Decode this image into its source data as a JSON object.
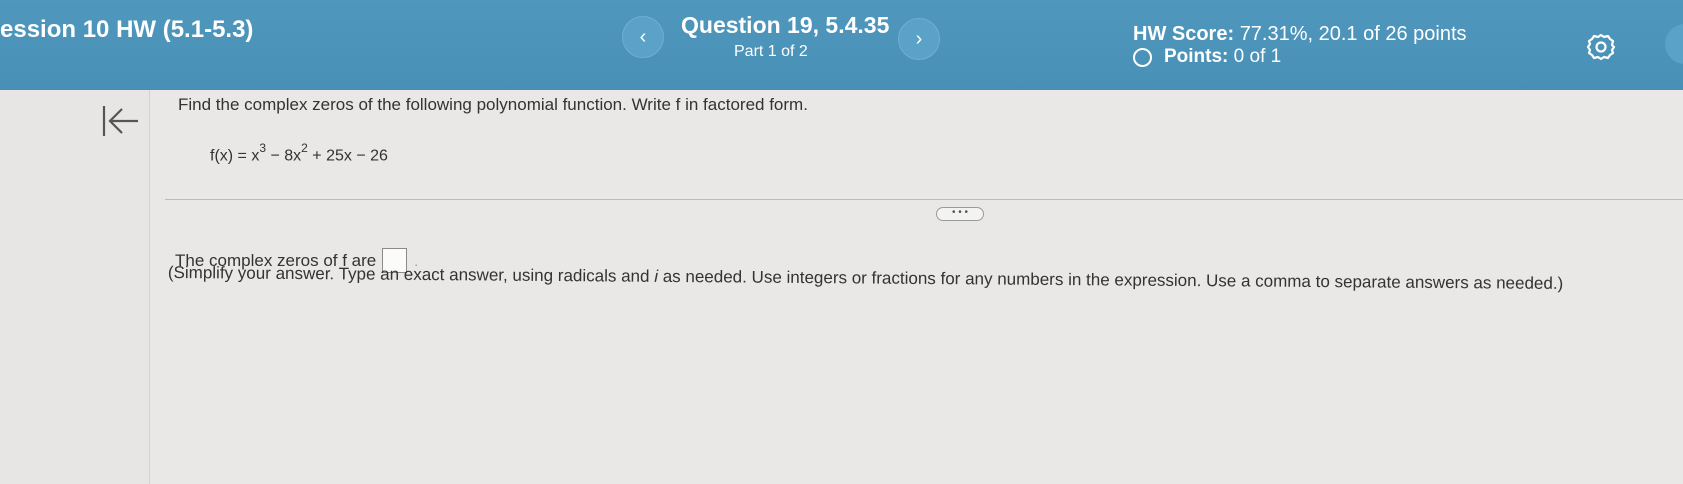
{
  "header": {
    "hw_title": "ession 10 HW (5.1-5.3)",
    "prev_label": "‹",
    "next_label": "›",
    "question_title": "Question 19, 5.4.35",
    "question_part": "Part 1 of 2",
    "score_label": "HW Score:",
    "score_value": "77.31%, 20.1 of 26 points",
    "points_label": "Points:",
    "points_value": "0 of 1"
  },
  "question": {
    "prompt": "Find the complex zeros of the following polynomial function. Write f in factored form.",
    "formula_parts": {
      "lhs": "f(x) = x",
      "exp1": "3",
      "mid": " − 8x",
      "exp2": "2",
      "rhs": " + 25x − 26"
    },
    "more_label": "• • •"
  },
  "answer": {
    "label": "The complex zeros of f are",
    "value": "",
    "trailing": ".",
    "instructions_start": "(Simplify your answer. Type an exact answer, using radicals and ",
    "instructions_var": "i",
    "instructions_end": " as needed. Use integers or fractions for any numbers in the expression. Use a comma to separate answers as needed.)"
  },
  "icons": {
    "back": "collapse-left-icon",
    "settings": "gear-icon",
    "points_status": "empty-circle-icon"
  },
  "colors": {
    "header_bg": "#4c93b9",
    "page_bg": "#e9e8e6",
    "text": "#333333"
  }
}
